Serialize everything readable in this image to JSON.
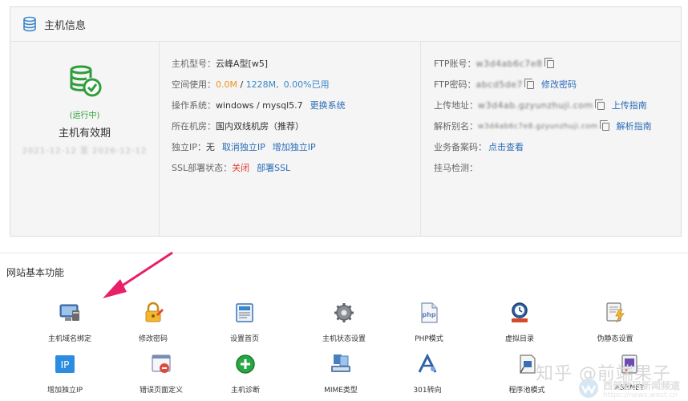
{
  "panel": {
    "title": "主机信息",
    "status": "(运行中)",
    "valid_label": "主机有效期",
    "valid_range": "2021-12-12 至 2026-12-12"
  },
  "info": {
    "model_label": "主机型号：",
    "model_value": "云峰A型[w5]",
    "space_label": "空间使用：",
    "space_used": "0.0M",
    "space_sep": " / ",
    "space_total": "1228M,",
    "space_pct": "0.00%已用",
    "os_label": "操作系统：",
    "os_value": "windows / mysql5.7",
    "os_link": "更换系统",
    "room_label": "所在机房：",
    "room_value": "国内双线机房（推荐）",
    "ip_label": "独立IP：",
    "ip_value": "无",
    "ip_cancel": "取消独立IP",
    "ip_add": "增加独立IP",
    "ssl_label": "SSL部署状态：",
    "ssl_value": "关闭",
    "ssl_link": "部署SSL"
  },
  "ftp": {
    "account_label": "FTP账号：",
    "account_value": "w3d4ab6c7e8",
    "pwd_label": "FTP密码：",
    "pwd_value": "abcd5de7",
    "pwd_link": "修改密码",
    "upload_label": "上传地址：",
    "upload_value": "w3d4ab.gzyunzhuji.com",
    "upload_link": "上传指南",
    "alias_label": "解析别名：",
    "alias_value": "w3d4ab6c7e8.gzyunzhuji.com",
    "alias_link": "解析指南",
    "beian_label": "业务备案码：",
    "beian_link": "点击查看",
    "trojan_label": "挂马检测："
  },
  "functions": {
    "title": "网站基本功能",
    "items": [
      {
        "label": "主机域名绑定",
        "icon": "domain-bind-icon"
      },
      {
        "label": "修改密码",
        "icon": "password-lock-icon"
      },
      {
        "label": "设置首页",
        "icon": "homepage-doc-icon"
      },
      {
        "label": "主机状态设置",
        "icon": "gear-icon"
      },
      {
        "label": "PHP模式",
        "icon": "php-icon"
      },
      {
        "label": "虚拟目录",
        "icon": "virtual-dir-icon"
      },
      {
        "label": "伪静态设置",
        "icon": "rewrite-doc-icon"
      },
      {
        "label": "增加独立IP",
        "icon": "ip-icon"
      },
      {
        "label": "错误页面定义",
        "icon": "error-page-icon"
      },
      {
        "label": "主机诊断",
        "icon": "diagnose-plus-icon"
      },
      {
        "label": "MIME类型",
        "icon": "mime-icon"
      },
      {
        "label": "301转向",
        "icon": "redirect-301-icon"
      },
      {
        "label": "程序池模式",
        "icon": "app-pool-icon"
      },
      {
        "label": "ASP.NET",
        "icon": "aspnet-icon"
      }
    ]
  },
  "watermark": {
    "zhihu": "知乎 @前端果子",
    "site_name": "西部数码新闻频道",
    "site_url": "https://news.west.cn"
  },
  "colors": {
    "link": "#2b6cb8",
    "running": "#2e9d3a",
    "used": "#f0941d",
    "total": "#3a87c8",
    "off": "#e03c31",
    "arrow": "#e8206a"
  }
}
